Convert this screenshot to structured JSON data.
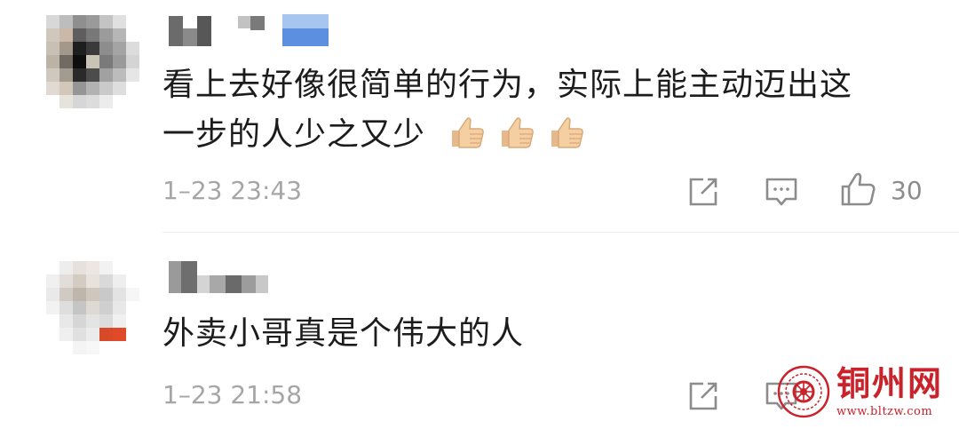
{
  "comments": [
    {
      "text_line1": "看上去好像很简单的行为，实际上能主动迈出这",
      "text_line2": "一步的人少之又少",
      "emoji": [
        "thumbs-up",
        "thumbs-up",
        "thumbs-up"
      ],
      "time": "1–23 23:43",
      "like_count": "30"
    },
    {
      "text_line1": "外卖小哥真是个伟大的人",
      "time": "1–23 21:58"
    }
  ],
  "icons": {
    "share": "share-icon",
    "reply": "comment-icon",
    "like": "thumbs-up-icon"
  },
  "watermark": {
    "title": "铜州网",
    "url": "www.bltzw.com"
  },
  "colors": {
    "meta_gray": "#a6a6a6",
    "icon_gray": "#8c8c8c",
    "watermark_red": "#c9222b"
  }
}
